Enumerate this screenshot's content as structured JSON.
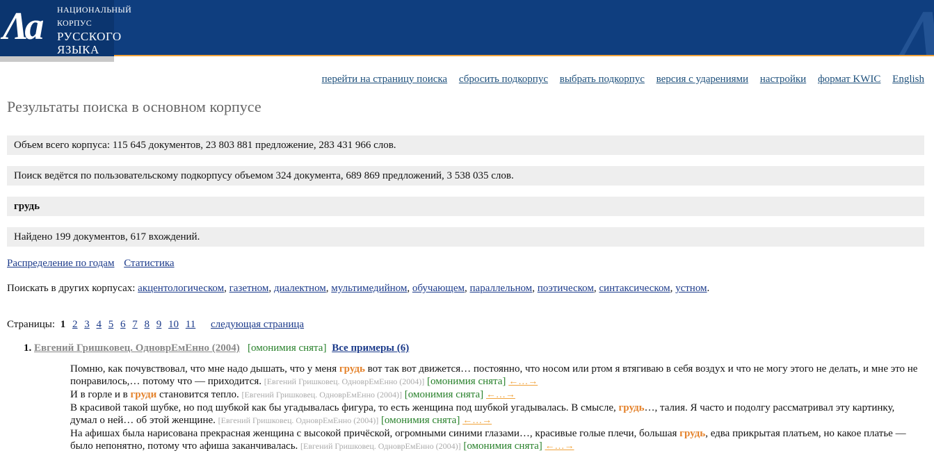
{
  "logo": {
    "line1": "НАЦИОНАЛЬНЫЙ КОРПУС",
    "line2": "РУССКОГО",
    "line3": "ЯЗЫКА"
  },
  "nav": [
    "перейти на страницу поиска",
    "сбросить подкорпус",
    "выбрать подкорпус",
    "версия с ударениями",
    "настройки",
    "формат KWIC",
    "English"
  ],
  "title": "Результаты поиска в основном корпусе",
  "info": {
    "corpus_size": "Объем всего корпуса: 115 645 документов, 23 803 881 предложение, 283 431 966 слов.",
    "subcorpus": "Поиск ведётся по пользовательскому подкорпусу объемом 324 документа, 689 869 предложений, 3 538 035 слов.",
    "query": "грудь",
    "found": "Найдено 199 документов, 617 вхождений."
  },
  "stats_links": [
    "Распределение по годам",
    "Статистика"
  ],
  "other_corpora": {
    "label": "Поискать в других корпусах:",
    "links": [
      "акцентологическом",
      "газетном",
      "диалектном",
      "мультимедийном",
      "обучающем",
      "параллельном",
      "поэтическом",
      "синтаксическом",
      "устном"
    ]
  },
  "pages": {
    "label": "Страницы:",
    "current": "1",
    "links": [
      "2",
      "3",
      "4",
      "5",
      "6",
      "7",
      "8",
      "9",
      "10",
      "11"
    ],
    "next": "следующая страница"
  },
  "document": {
    "num": "1.",
    "author_title": "Евгений Гришковец. ОдноврЕмЕнно (2004)",
    "homonymy": "[омонимия снята]",
    "all_examples": "Все примеры (6)"
  },
  "snippets": [
    {
      "before": "Помню, как почувствовал, что мне надо дышать, что у меня ",
      "hit": "грудь",
      "after": " вот так вот движется… постоянно, что носом или ртом я втягиваю в себя воздух и что не могу этого не делать, и мне это не понравилось,… потому что — приходится. ",
      "source": "[Евгений Гришковец. ОдноврЕмЕнно (2004)]",
      "homonymy": "[омонимия снята]",
      "arrows": "←…→"
    },
    {
      "before": "И в горле и в ",
      "hit": "груди",
      "after": " становится тепло. ",
      "source": "[Евгений Гришковец. ОдноврЕмЕнно (2004)]",
      "homonymy": "[омонимия снята]",
      "arrows": "←…→"
    },
    {
      "before": "В красивой такой шубке, но под шубкой как бы угадывалась фигура, то есть женщина под шубкой угадывалась. В смысле, ",
      "hit": "грудь",
      "after": "…, талия. Я часто и подолгу рассматривал эту картинку, думал о ней… об этой женщине. ",
      "source": "[Евгений Гришковец. ОдноврЕмЕнно (2004)]",
      "homonymy": "[омонимия снята]",
      "arrows": "←…→"
    },
    {
      "before": "На афишах была нарисована прекрасная женщина с высокой причёской, огромными синими глазами…, красивые голые плечи, большая ",
      "hit": "грудь",
      "after": ", едва прикрытая платьем, но какое платье — было непонятно, потому что афиша заканчивалась. ",
      "source": "[Евгений Гришковец. ОдноврЕмЕнно (2004)]",
      "homonymy": "[омонимия снята]",
      "arrows": "←…→"
    }
  ]
}
